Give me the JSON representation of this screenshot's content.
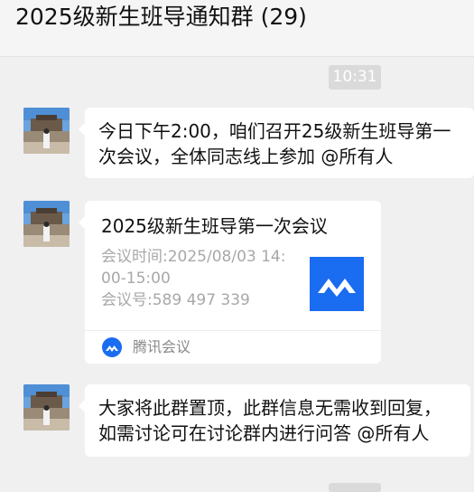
{
  "chat": {
    "title": "2025级新生班导通知群 (29)",
    "timestamp": "10:31"
  },
  "messages": [
    {
      "type": "text",
      "lines": [
        "今日下午2:00，咱们召开25级新生班导第一",
        "次会议，全体同志线上参加 @所有人"
      ]
    },
    {
      "type": "meeting-card",
      "title": "2025级新生班导第一次会议",
      "time_line1": "会议时间:2025/08/03 14:",
      "time_line2": "00-15:00",
      "meeting_no": "会议号:589 497 339",
      "app_name": "腾讯会议",
      "brand_color": "#1a6cf0"
    },
    {
      "type": "text",
      "lines": [
        "大家将此群置顶，此群信息无需收到回复，",
        "如需讨论可在讨论群内进行问答 @所有人"
      ]
    }
  ]
}
